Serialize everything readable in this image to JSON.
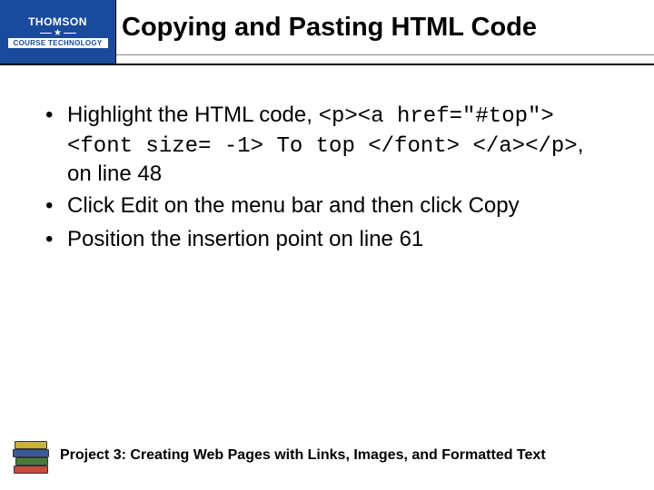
{
  "logo": {
    "brand": "THOMSON",
    "subbrand": "COURSE TECHNOLOGY"
  },
  "title": "Copying and Pasting HTML Code",
  "bullets": [
    {
      "pre": "Highlight the HTML code, ",
      "code": "<p><a href=\"#top\"><font size= -1> To top </font> </a></p>",
      "post": ", on line 48"
    },
    {
      "pre": "Click Edit on the menu bar and then click Copy",
      "code": "",
      "post": ""
    },
    {
      "pre": "Position the insertion point on line 61",
      "code": "",
      "post": ""
    }
  ],
  "footer": "Project 3: Creating Web Pages with Links, Images, and Formatted Text"
}
